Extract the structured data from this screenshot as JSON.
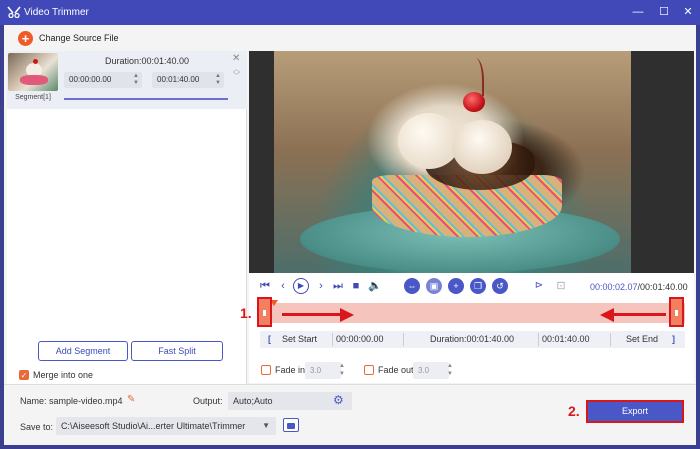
{
  "window": {
    "title": "Video Trimmer",
    "minimize": "—",
    "maximize": "☐",
    "close": "✕"
  },
  "source": {
    "change_label": "Change Source File"
  },
  "segment": {
    "label": "Segment[1]",
    "duration": "Duration:00:01:40.00",
    "start": "00:00:00.00",
    "end": "00:01:40.00"
  },
  "left_buttons": {
    "add_segment": "Add Segment",
    "fast_split": "Fast Split",
    "merge_label": "Merge into one",
    "merge_checked": true
  },
  "player": {
    "current_time": "00:00:02.07",
    "total_time": "/00:01:40.00"
  },
  "annotations": {
    "step1": "1.",
    "step2": "2."
  },
  "trim_row": {
    "set_start": "Set Start",
    "start_value": "00:00:00.00",
    "duration": "Duration:00:01:40.00",
    "end_value": "00:01:40.00",
    "set_end": "Set End"
  },
  "fade": {
    "in_label": "Fade in",
    "in_value": "3.0",
    "out_label": "Fade out",
    "out_value": "3.0"
  },
  "output": {
    "name_label": "Name:",
    "name_value": "sample-video.mp4",
    "output_label": "Output:",
    "output_value": "Auto;Auto",
    "save_label": "Save to:",
    "save_value": "C:\\Aiseesoft Studio\\Ai...erter Ultimate\\Trimmer",
    "export_label": "Export"
  },
  "colors": {
    "accent": "#4a57c7",
    "titlebar": "#4149b8",
    "orange": "#f05a28",
    "highlight_red": "#d9161c"
  }
}
